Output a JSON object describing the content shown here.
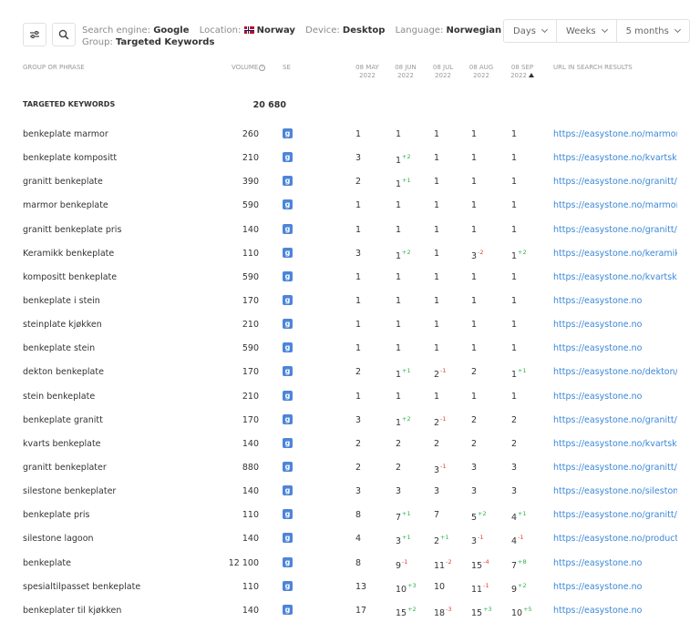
{
  "header": {
    "search_engine_label": "Search engine:",
    "search_engine": "Google",
    "location_label": "Location:",
    "location": "Norway",
    "device_label": "Device:",
    "device": "Desktop",
    "language_label": "Language:",
    "language": "Norwegian",
    "group_label": "Group:",
    "group": "Targeted Keywords",
    "range_buttons": [
      "Days",
      "Weeks",
      "5 months"
    ]
  },
  "columns": {
    "phrase": "GROUP OR PHRASE",
    "volume": "VOLUME",
    "se": "SE",
    "dates": [
      {
        "day": "08 MAY",
        "year": "2022"
      },
      {
        "day": "08 JUN",
        "year": "2022"
      },
      {
        "day": "08 JUL",
        "year": "2022"
      },
      {
        "day": "08 AUG",
        "year": "2022"
      },
      {
        "day": "08 SEP",
        "year": "2022"
      }
    ],
    "url": "URL IN SEARCH RESULTS"
  },
  "group_row": {
    "label": "TARGETED KEYWORDS",
    "volume": "20 680"
  },
  "rows": [
    {
      "phrase": "benkeplate marmor",
      "volume": "260",
      "pos": [
        [
          "1",
          ""
        ],
        [
          "1",
          ""
        ],
        [
          "1",
          ""
        ],
        [
          "1",
          ""
        ],
        [
          "1",
          ""
        ]
      ],
      "url": "https://easystone.no/marmorisen"
    },
    {
      "phrase": "benkeplate kompositt",
      "volume": "210",
      "pos": [
        [
          "3",
          ""
        ],
        [
          "1",
          "+2"
        ],
        [
          "1",
          ""
        ],
        [
          "1",
          ""
        ],
        [
          "1",
          ""
        ]
      ],
      "url": "https://easystone.no/kvartskompositt"
    },
    {
      "phrase": "granitt benkeplate",
      "volume": "390",
      "pos": [
        [
          "2",
          ""
        ],
        [
          "1",
          "+1"
        ],
        [
          "1",
          ""
        ],
        [
          "1",
          ""
        ],
        [
          "1",
          ""
        ]
      ],
      "url": "https://easystone.no/granitt/"
    },
    {
      "phrase": "marmor benkeplate",
      "volume": "590",
      "pos": [
        [
          "1",
          ""
        ],
        [
          "1",
          ""
        ],
        [
          "1",
          ""
        ],
        [
          "1",
          ""
        ],
        [
          "1",
          ""
        ]
      ],
      "url": "https://easystone.no/marmorisen"
    },
    {
      "phrase": "granitt benkeplate pris",
      "volume": "140",
      "pos": [
        [
          "1",
          ""
        ],
        [
          "1",
          ""
        ],
        [
          "1",
          ""
        ],
        [
          "1",
          ""
        ],
        [
          "1",
          ""
        ]
      ],
      "url": "https://easystone.no/granitt/"
    },
    {
      "phrase": "Keramikk benkeplate",
      "volume": "110",
      "pos": [
        [
          "3",
          ""
        ],
        [
          "1",
          "+2"
        ],
        [
          "1",
          ""
        ],
        [
          "3",
          "-2"
        ],
        [
          "1",
          "+2"
        ]
      ],
      "url": "https://easystone.no/keramikk/"
    },
    {
      "phrase": "kompositt benkeplate",
      "volume": "590",
      "pos": [
        [
          "1",
          ""
        ],
        [
          "1",
          ""
        ],
        [
          "1",
          ""
        ],
        [
          "1",
          ""
        ],
        [
          "1",
          ""
        ]
      ],
      "url": "https://easystone.no/kvartskompositt"
    },
    {
      "phrase": "benkeplate i stein",
      "volume": "170",
      "pos": [
        [
          "1",
          ""
        ],
        [
          "1",
          ""
        ],
        [
          "1",
          ""
        ],
        [
          "1",
          ""
        ],
        [
          "1",
          ""
        ]
      ],
      "url": "https://easystone.no"
    },
    {
      "phrase": "steinplate kjøkken",
      "volume": "210",
      "pos": [
        [
          "1",
          ""
        ],
        [
          "1",
          ""
        ],
        [
          "1",
          ""
        ],
        [
          "1",
          ""
        ],
        [
          "1",
          ""
        ]
      ],
      "url": "https://easystone.no"
    },
    {
      "phrase": "benkeplate stein",
      "volume": "590",
      "pos": [
        [
          "1",
          ""
        ],
        [
          "1",
          ""
        ],
        [
          "1",
          ""
        ],
        [
          "1",
          ""
        ],
        [
          "1",
          ""
        ]
      ],
      "url": "https://easystone.no"
    },
    {
      "phrase": "dekton benkeplate",
      "volume": "170",
      "pos": [
        [
          "2",
          ""
        ],
        [
          "1",
          "+1"
        ],
        [
          "2",
          "-1"
        ],
        [
          "2",
          ""
        ],
        [
          "1",
          "+1"
        ]
      ],
      "url": "https://easystone.no/dekton/"
    },
    {
      "phrase": "stein benkeplate",
      "volume": "210",
      "pos": [
        [
          "1",
          ""
        ],
        [
          "1",
          ""
        ],
        [
          "1",
          ""
        ],
        [
          "1",
          ""
        ],
        [
          "1",
          ""
        ]
      ],
      "url": "https://easystone.no"
    },
    {
      "phrase": "benkeplate granitt",
      "volume": "170",
      "pos": [
        [
          "3",
          ""
        ],
        [
          "1",
          "+2"
        ],
        [
          "2",
          "-1"
        ],
        [
          "2",
          ""
        ],
        [
          "2",
          ""
        ]
      ],
      "url": "https://easystone.no/granitt/"
    },
    {
      "phrase": "kvarts benkeplate",
      "volume": "140",
      "pos": [
        [
          "2",
          ""
        ],
        [
          "2",
          ""
        ],
        [
          "2",
          ""
        ],
        [
          "2",
          ""
        ],
        [
          "2",
          ""
        ]
      ],
      "url": "https://easystone.no/kvartskompositt"
    },
    {
      "phrase": "granitt benkeplater",
      "volume": "880",
      "pos": [
        [
          "2",
          ""
        ],
        [
          "2",
          ""
        ],
        [
          "3",
          "-1"
        ],
        [
          "3",
          ""
        ],
        [
          "3",
          ""
        ]
      ],
      "url": "https://easystone.no/granitt/"
    },
    {
      "phrase": "silestone benkeplater",
      "volume": "140",
      "pos": [
        [
          "3",
          ""
        ],
        [
          "3",
          ""
        ],
        [
          "3",
          ""
        ],
        [
          "3",
          ""
        ],
        [
          "3",
          ""
        ]
      ],
      "url": "https://easystone.no/silestone/"
    },
    {
      "phrase": "benkeplate pris",
      "volume": "110",
      "pos": [
        [
          "8",
          ""
        ],
        [
          "7",
          "+1"
        ],
        [
          "7",
          ""
        ],
        [
          "5",
          "+2"
        ],
        [
          "4",
          "+1"
        ]
      ],
      "url": "https://easystone.no/granitt/"
    },
    {
      "phrase": "silestone lagoon",
      "volume": "140",
      "pos": [
        [
          "4",
          ""
        ],
        [
          "3",
          "+1"
        ],
        [
          "2",
          "+1"
        ],
        [
          "3",
          "-1"
        ],
        [
          "4",
          "-1"
        ]
      ],
      "url": "https://easystone.no/product/lagoon"
    },
    {
      "phrase": "benkeplate",
      "volume": "12 100",
      "pos": [
        [
          "8",
          ""
        ],
        [
          "9",
          "-1"
        ],
        [
          "11",
          "-2"
        ],
        [
          "15",
          "-4"
        ],
        [
          "7",
          "+8"
        ]
      ],
      "url": "https://easystone.no"
    },
    {
      "phrase": "spesialtilpasset benkeplate",
      "volume": "110",
      "pos": [
        [
          "13",
          ""
        ],
        [
          "10",
          "+3"
        ],
        [
          "10",
          ""
        ],
        [
          "11",
          "-1"
        ],
        [
          "9",
          "+2"
        ]
      ],
      "url": "https://easystone.no"
    },
    {
      "phrase": "benkeplater til kjøkken",
      "volume": "140",
      "pos": [
        [
          "17",
          ""
        ],
        [
          "15",
          "+2"
        ],
        [
          "18",
          "-3"
        ],
        [
          "15",
          "+3"
        ],
        [
          "10",
          "+5"
        ]
      ],
      "url": "https://easystone.no"
    }
  ]
}
